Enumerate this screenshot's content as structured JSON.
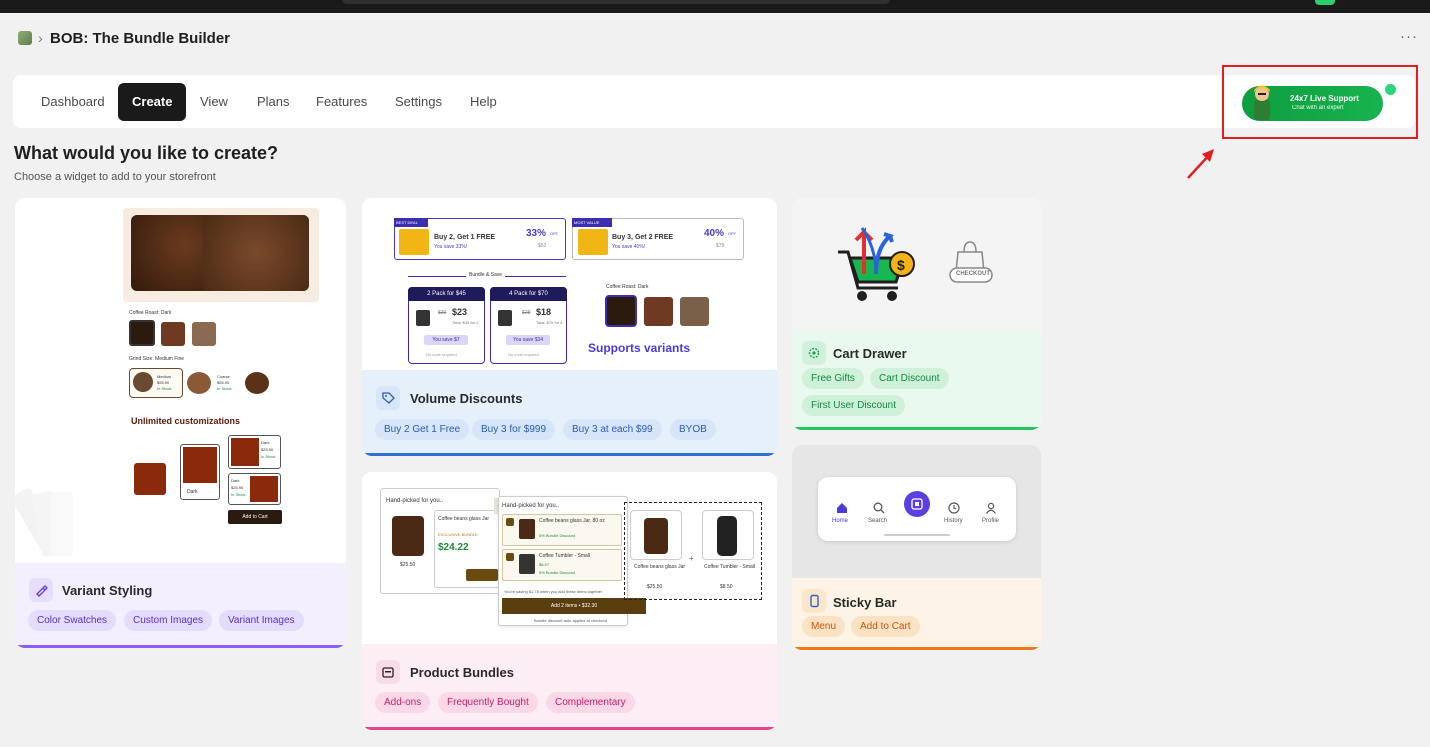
{
  "app": {
    "title": "BOB: The Bundle Builder",
    "more": "···",
    "crumb_sep": "›"
  },
  "nav": {
    "tabs": [
      "Dashboard",
      "Create",
      "View",
      "Plans",
      "Features",
      "Settings",
      "Help"
    ],
    "active": "Create"
  },
  "support": {
    "title": "24x7 Live Support",
    "subtitle": "Chat with an expert"
  },
  "page": {
    "heading": "What would you like to create?",
    "subheading": "Choose a widget to add to your storefront"
  },
  "cards": {
    "variant": {
      "title": "Variant Styling",
      "chips": [
        "Color Swatches",
        "Custom Images",
        "Variant Images"
      ],
      "preview": {
        "roast_label": "Coffee Roast: Dark",
        "grind_label": "Grind Size: Medium Fine",
        "grind_options": [
          {
            "name": "Medium",
            "price": "$55.90",
            "stock": "In Stock"
          },
          {
            "name": "Coarse",
            "price": "$55.90",
            "stock": "In Stock"
          }
        ],
        "caption": "Unlimited customizations",
        "dark_label": "Dark",
        "swatch_price": "$25.90",
        "swatch_stock": "In Stock",
        "add_to_cart": "Add to Cart"
      }
    },
    "volume": {
      "title": "Volume Discounts",
      "chips": [
        "Buy 2 Get 1 Free",
        "Buy 3 for $999",
        "Buy 3 at each $99",
        "BYOB"
      ],
      "preview": {
        "deal1_badge": "BEST DEAL",
        "deal1_title": "Buy 2, Get 1 FREE",
        "deal1_save": "You save 33%!",
        "deal1_pct": "33%",
        "deal1_off": "OFF",
        "deal1_price": "$52",
        "deal2_badge": "MOST VALUE",
        "deal2_title": "Buy 3, Get 2 FREE",
        "deal2_save": "You save 40%!",
        "deal2_pct": "40%",
        "deal2_off": "OFF",
        "deal2_price": "$79",
        "bundle_label": "Bundle & Save",
        "pack1": "2 Pack for $45",
        "pack1_was": "$30",
        "pack1_now": "$23",
        "pack1_total": "Total: $45 for 2",
        "pack1_save": "You save $7",
        "pack2": "4 Pack for $70",
        "pack2_was": "$28",
        "pack2_now": "$18",
        "pack2_total": "Total: $70 for 4",
        "pack2_save": "You save $34",
        "no_code": "No code required",
        "roast_label": "Coffee Roast: Dark",
        "variants_caption": "Supports variants"
      }
    },
    "cart": {
      "title": "Cart Drawer",
      "chips": [
        "Free Gifts",
        "Cart Discount",
        "First User Discount"
      ],
      "checkout_label": "CHECKOUT"
    },
    "bundles": {
      "title": "Product Bundles",
      "chips": [
        "Add-ons",
        "Frequently Bought",
        "Complementary"
      ],
      "preview": {
        "handpicked": "Hand-picked for you..",
        "item1": "Coffee beans glass Jar, 80 oz",
        "item1_short": "Coffee beans glass Jar",
        "exclusive": "EXCLUSIVE BUNDLE",
        "price_big": "$24.22",
        "price_small": "$25.50",
        "item2": "Coffee Tumbler - Small",
        "price2": "$8.50",
        "price2_small": "$8.57",
        "bundle_discount": "5% Bundle Discount",
        "saving_note": "You're saving $1.78 when you add these items together",
        "add_btn": "Add 2 items • $32.30",
        "fine_print": "Bundle discount auto applied at checkout"
      }
    },
    "sticky": {
      "title": "Sticky Bar",
      "chips": [
        "Menu",
        "Add to Cart"
      ],
      "nav_items": [
        "Home",
        "Search",
        "",
        "History",
        "Profile"
      ]
    }
  }
}
